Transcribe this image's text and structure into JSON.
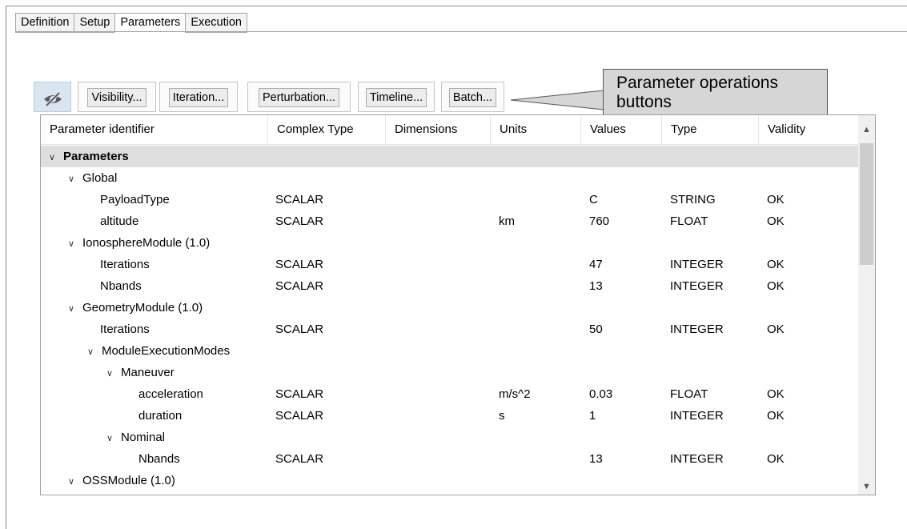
{
  "tabs": [
    "Definition",
    "Setup",
    "Parameters",
    "Execution"
  ],
  "toolbar": {
    "eye_icon": "eye-slash-icon",
    "visibility": "Visibility...",
    "iteration": "Iteration...",
    "perturbation": "Perturbation...",
    "timeline": "Timeline...",
    "batch": "Batch..."
  },
  "callout": {
    "text": "Parameter operations buttons"
  },
  "table": {
    "headers": [
      "Parameter identifier",
      "Complex Type",
      "Dimensions",
      "Units",
      "Values",
      "Type",
      "Validity"
    ],
    "rows": [
      {
        "id": "Parameters",
        "depth": 0,
        "expander": true,
        "bold": true,
        "ctype": "",
        "dims": "",
        "units": "",
        "value": "",
        "type": "",
        "valid": ""
      },
      {
        "id": "Global",
        "depth": 1,
        "expander": true,
        "ctype": "",
        "dims": "",
        "units": "",
        "value": "",
        "type": "",
        "valid": ""
      },
      {
        "id": "PayloadType",
        "depth": 2,
        "ctype": "SCALAR",
        "dims": "",
        "units": "",
        "value": "C",
        "type": "STRING",
        "valid": "OK"
      },
      {
        "id": "altitude",
        "depth": 2,
        "ctype": "SCALAR",
        "dims": "",
        "units": "km",
        "value": "760",
        "type": "FLOAT",
        "valid": "OK"
      },
      {
        "id": "IonosphereModule (1.0)",
        "depth": 1,
        "expander": true,
        "ctype": "",
        "dims": "",
        "units": "",
        "value": "",
        "type": "",
        "valid": ""
      },
      {
        "id": "Iterations",
        "depth": 2,
        "ctype": "SCALAR",
        "dims": "",
        "units": "",
        "value": "47",
        "type": "INTEGER",
        "valid": "OK"
      },
      {
        "id": "Nbands",
        "depth": 2,
        "ctype": "SCALAR",
        "dims": "",
        "units": "",
        "value": "13",
        "type": "INTEGER",
        "valid": "OK"
      },
      {
        "id": "GeometryModule (1.0)",
        "depth": 1,
        "expander": true,
        "ctype": "",
        "dims": "",
        "units": "",
        "value": "",
        "type": "",
        "valid": ""
      },
      {
        "id": "Iterations",
        "depth": 2,
        "ctype": "SCALAR",
        "dims": "",
        "units": "",
        "value": "50",
        "type": "INTEGER",
        "valid": "OK"
      },
      {
        "id": "ModuleExecutionModes",
        "depth": 2,
        "expander": true,
        "ctype": "",
        "dims": "",
        "units": "",
        "value": "",
        "type": "",
        "valid": ""
      },
      {
        "id": "Maneuver",
        "depth": 3,
        "expander": true,
        "ctype": "",
        "dims": "",
        "units": "",
        "value": "",
        "type": "",
        "valid": ""
      },
      {
        "id": "acceleration",
        "depth": 4,
        "ctype": "SCALAR",
        "dims": "",
        "units": "m/s^2",
        "value": "0.03",
        "type": "FLOAT",
        "valid": "OK"
      },
      {
        "id": "duration",
        "depth": 4,
        "ctype": "SCALAR",
        "dims": "",
        "units": "s",
        "value": "1",
        "type": "INTEGER",
        "valid": "OK"
      },
      {
        "id": "Nominal",
        "depth": 3,
        "expander": true,
        "ctype": "",
        "dims": "",
        "units": "",
        "value": "",
        "type": "",
        "valid": ""
      },
      {
        "id": "Nbands",
        "depth": 4,
        "ctype": "SCALAR",
        "dims": "",
        "units": "",
        "value": "13",
        "type": "INTEGER",
        "valid": "OK"
      },
      {
        "id": "OSSModule (1.0)",
        "depth": 1,
        "expander": true,
        "ctype": "",
        "dims": "",
        "units": "",
        "value": "",
        "type": "",
        "valid": ""
      }
    ]
  },
  "colors": {
    "selected_row": "#dedede",
    "callout_bg": "#d6d6d6"
  }
}
